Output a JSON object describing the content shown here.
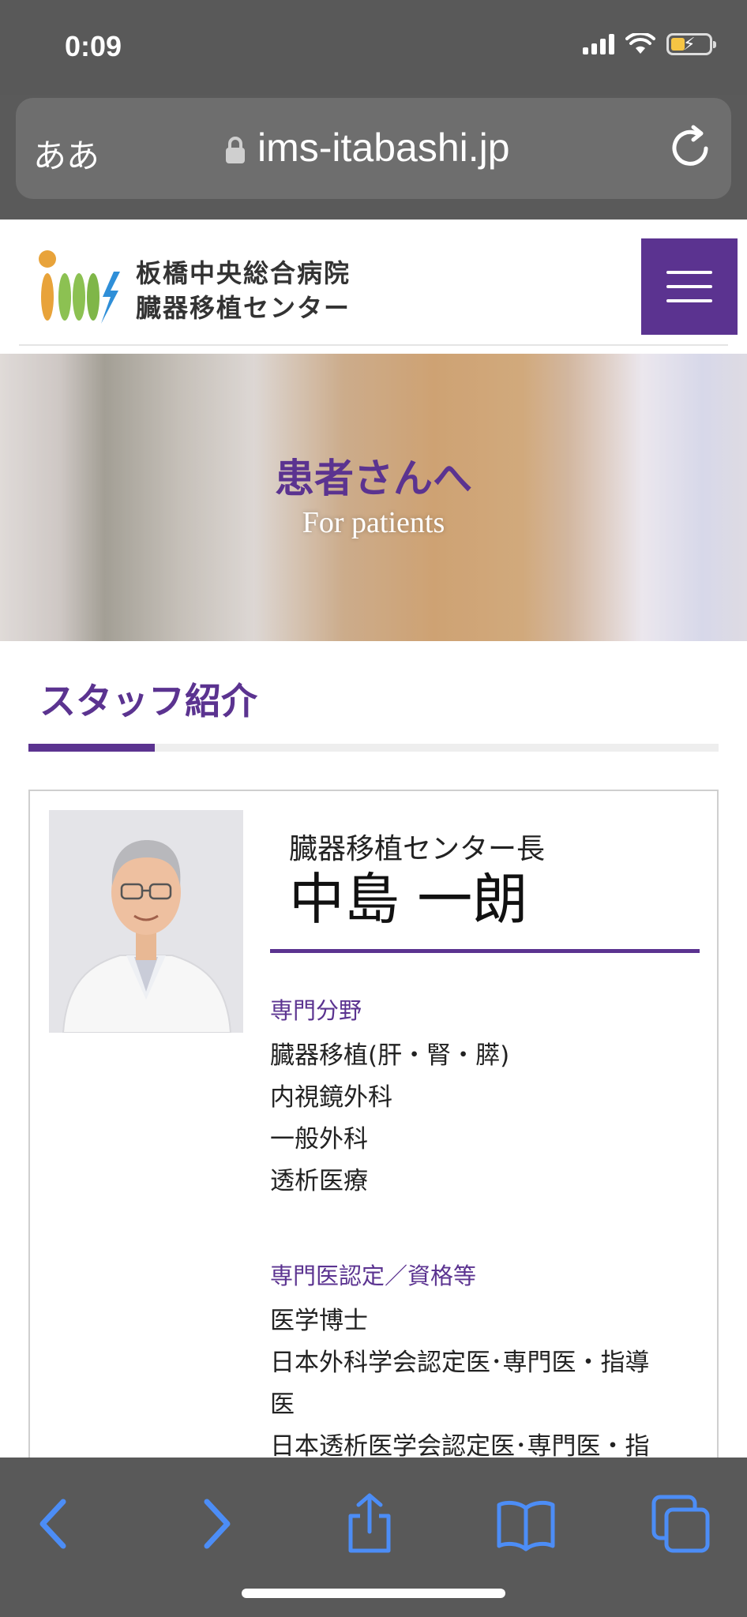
{
  "status_bar": {
    "time": "0:09"
  },
  "browser": {
    "aa_label": "ああ",
    "url": "ims-itabashi.jp"
  },
  "site": {
    "logo_line1": "板橋中央総合病院",
    "logo_line2": "臓器移植センター"
  },
  "hero": {
    "title": "患者さんへ",
    "subtitle": "For patients"
  },
  "section": {
    "title": "スタッフ紹介"
  },
  "staff": {
    "role": "臓器移植センター長",
    "name": "中島 一朗",
    "specialty_label": "専門分野",
    "specialties": [
      "臓器移植(肝・腎・膵)",
      "内視鏡外科",
      "一般外科",
      "透析医療"
    ],
    "qualifications_label": "専門医認定／資格等",
    "qualifications": [
      "医学博士",
      "日本外科学会認定医･専門医・指導",
      "医",
      "日本透析医学会認定医･専門医・指"
    ]
  },
  "colors": {
    "brand_purple": "#5b3390",
    "toolbar_blue": "#4c8df6"
  }
}
